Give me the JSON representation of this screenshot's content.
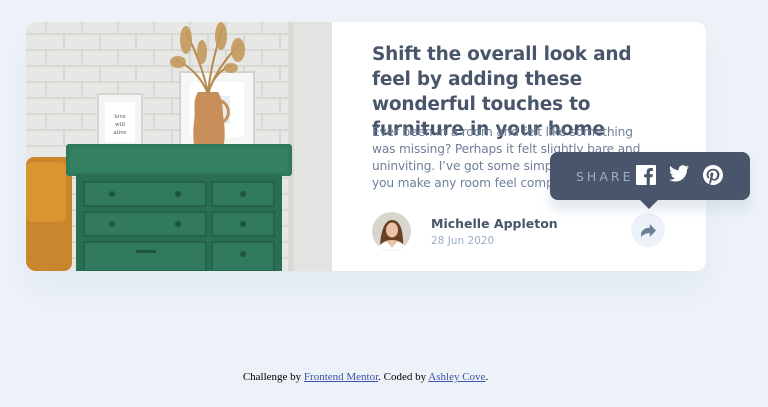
{
  "article": {
    "title": "Shift the overall look and feel by adding these wonderful touches to furniture in your home",
    "description": "Ever been in a room and felt like something was missing? Perhaps it felt slightly bare and uninviting. I’ve got some simple tips to help you make any room feel complete.",
    "image_alt": "drawers"
  },
  "author": {
    "name": "Michelle Appleton",
    "date": "28 Jun 2020",
    "avatar_alt": "Michelle Appleton avatar"
  },
  "share": {
    "label": "SHARE",
    "icons": [
      "facebook-icon",
      "twitter-icon",
      "pinterest-icon",
      "share-icon"
    ]
  },
  "attribution": {
    "prefix": "Challenge by ",
    "link1": "Frontend Mentor",
    "middle": ". Coded by ",
    "link2": "Ashley Cove",
    "suffix": "."
  },
  "colors": {
    "background": "#ecf2f8",
    "card": "#ffffff",
    "heading": "#48556a",
    "body_text": "#6e8098",
    "muted": "#9eafc2",
    "popup": "#48556a"
  }
}
